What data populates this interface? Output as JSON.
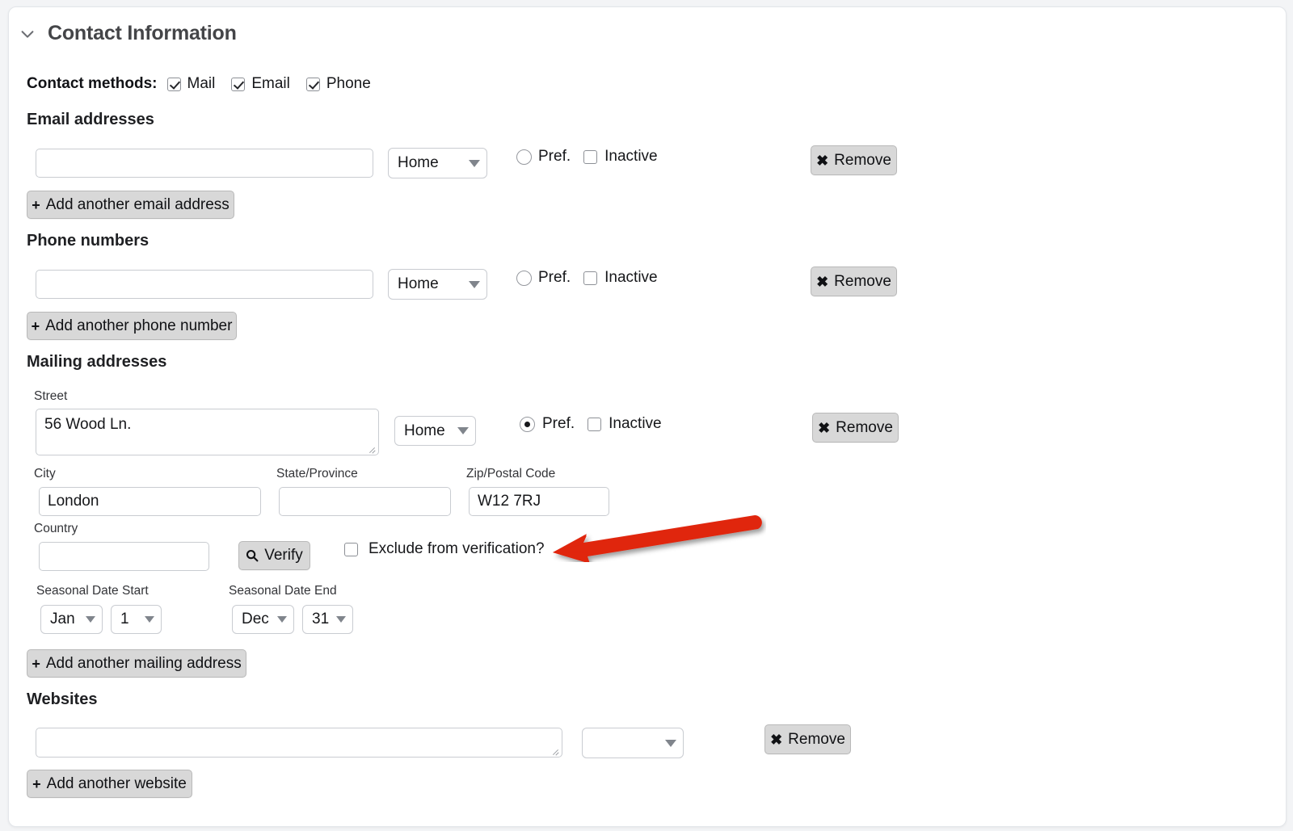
{
  "section": {
    "title": "Contact Information",
    "chevron_icon": "chevron-down-icon",
    "expanded": true
  },
  "contact_methods": {
    "label": "Contact methods:",
    "options": [
      {
        "label": "Mail",
        "checked": true
      },
      {
        "label": "Email",
        "checked": true
      },
      {
        "label": "Phone",
        "checked": true
      }
    ]
  },
  "email_addresses": {
    "group_title": "Email addresses",
    "rows": [
      {
        "value": "",
        "placeholder": "",
        "type_value": "Home",
        "pref_label": "Pref.",
        "pref_checked": false,
        "inactive_label": "Inactive",
        "inactive_checked": false,
        "remove_label": "Remove",
        "remove_glyph": "✖"
      }
    ],
    "add_label": "Add another email address",
    "add_glyph": "+"
  },
  "phone_numbers": {
    "group_title": "Phone numbers",
    "rows": [
      {
        "value": "",
        "placeholder": "",
        "type_value": "Home",
        "pref_label": "Pref.",
        "pref_checked": false,
        "inactive_label": "Inactive",
        "inactive_checked": false,
        "remove_label": "Remove",
        "remove_glyph": "✖"
      }
    ],
    "add_label": "Add another phone number",
    "add_glyph": "+"
  },
  "mailing_addresses": {
    "group_title": "Mailing addresses",
    "street_label": "Street",
    "street_value": "56 Wood Ln.",
    "type_value": "Home",
    "pref_label": "Pref.",
    "pref_checked": true,
    "inactive_label": "Inactive",
    "inactive_checked": false,
    "remove_label": "Remove",
    "remove_glyph": "✖",
    "city_label": "City",
    "city_value": "London",
    "state_label": "State/Province",
    "state_value": "",
    "zip_label": "Zip/Postal Code",
    "zip_value": "W12 7RJ",
    "country_label": "Country",
    "country_value": "",
    "verify_label": "Verify",
    "verify_icon": "search-icon",
    "exclude_label": "Exclude from verification?",
    "exclude_checked": false,
    "seasonal_start_label": "Seasonal Date Start",
    "seasonal_start_month": "Jan",
    "seasonal_start_day": "1",
    "seasonal_end_label": "Seasonal Date End",
    "seasonal_end_month": "Dec",
    "seasonal_end_day": "31",
    "add_label": "Add another mailing address",
    "add_glyph": "+"
  },
  "websites": {
    "group_title": "Websites",
    "rows": [
      {
        "value": "",
        "placeholder": "",
        "type_value": "",
        "remove_label": "Remove",
        "remove_glyph": "✖"
      }
    ],
    "add_label": "Add another website",
    "add_glyph": "+"
  },
  "annotation": {
    "kind": "arrow-pointing-left",
    "color": "#e0250f",
    "target": "Exclude from verification?"
  },
  "colors": {
    "page_background": "#f3f4f6",
    "card_background": "#ffffff",
    "button_face": "#d8d8d8",
    "input_border": "#c9ccd1",
    "text": "#16171a",
    "annotation_red": "#e0250f"
  }
}
